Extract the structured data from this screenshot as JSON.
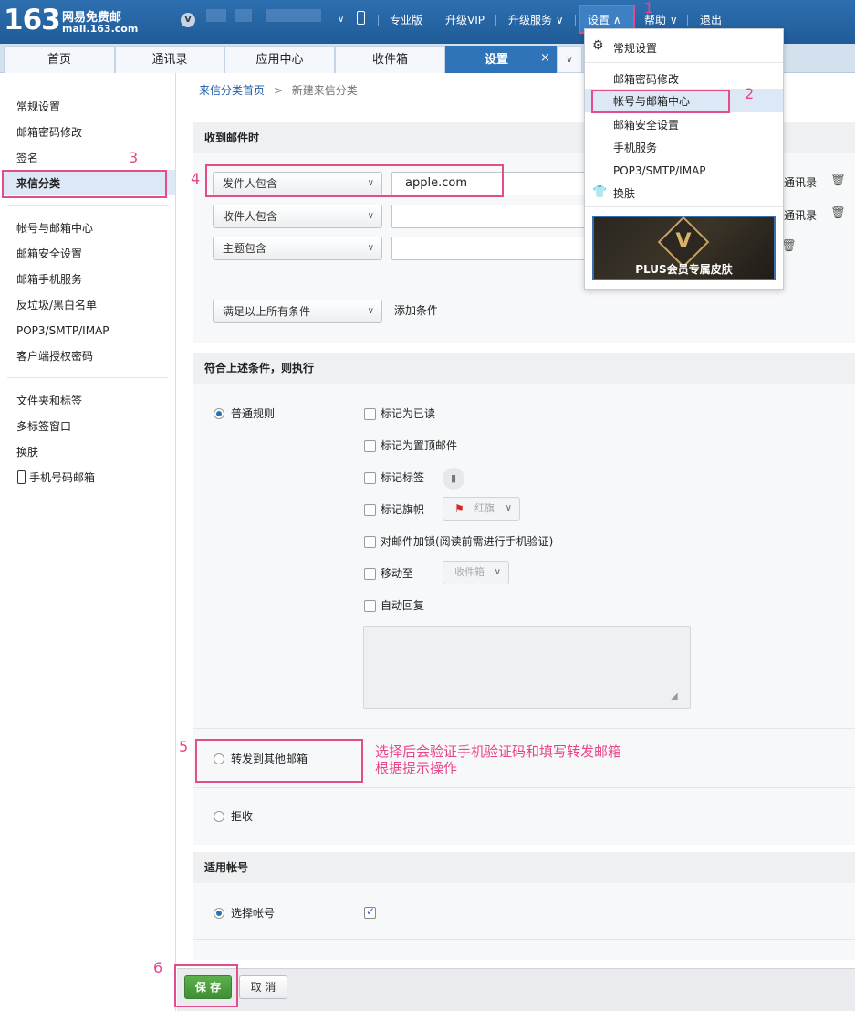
{
  "topbar": {
    "logo_num": "163",
    "logo_title": "网易免费邮",
    "logo_domain": "mail.163.com",
    "vip_badge": "V",
    "nav": [
      "专业版",
      "升级VIP",
      "升级服务 ∨",
      "设置 ∧",
      "帮助 ∨",
      "退出"
    ]
  },
  "tabs": [
    "首页",
    "通讯录",
    "应用中心",
    "收件箱",
    "设置"
  ],
  "tab_close": "×",
  "tab_more": "∨",
  "sidebar": {
    "group1": [
      "常规设置",
      "邮箱密码修改",
      "签名",
      "来信分类"
    ],
    "group2": [
      "帐号与邮箱中心",
      "邮箱安全设置",
      "邮箱手机服务",
      "反垃圾/黑白名单",
      "POP3/SMTP/IMAP",
      "客户端授权密码"
    ],
    "group3": [
      "文件夹和标签",
      "多标签窗口",
      "换肤",
      "手机号码邮箱"
    ]
  },
  "breadcrumb": {
    "home": "来信分类首页",
    "sep": ">",
    "current": "新建来信分类"
  },
  "section_receive": {
    "title": "收到邮件时",
    "conditions": [
      {
        "select": "发件人包含",
        "value": "apple.com",
        "contact_link": "通讯录"
      },
      {
        "select": "收件人包含",
        "value": "",
        "contact_link": "通讯录"
      },
      {
        "select": "主题包含",
        "value": "",
        "contact_link": ""
      }
    ],
    "match_select": "满足以上所有条件",
    "add_condition": "添加条件"
  },
  "section_action": {
    "title": "符合上述条件，则执行",
    "normal_rule": "普通规则",
    "options": [
      "标记为已读",
      "标记为置顶邮件",
      "标记标签",
      "标记旗帜",
      "对邮件加锁(阅读前需进行手机验证)",
      "移动至",
      "自动回复"
    ],
    "flag_select": "红旗",
    "move_select": "收件箱",
    "forward": "转发到其他邮箱",
    "reject": "拒收"
  },
  "annotation": {
    "line1": "选择后会验证手机验证码和填写转发邮箱",
    "line2": "根据提示操作"
  },
  "section_account": {
    "title": "适用帐号",
    "select_account": "选择帐号"
  },
  "buttons": {
    "save": "保 存",
    "cancel": "取 消"
  },
  "dropdown_menu": {
    "items": [
      "常规设置",
      "邮箱密码修改",
      "帐号与邮箱中心",
      "邮箱安全设置",
      "手机服务",
      "POP3/SMTP/IMAP",
      "换肤"
    ],
    "promo": "PLUS会员专属皮肤",
    "promo_logo": "V"
  },
  "step_numbers": [
    "1",
    "2",
    "3",
    "4",
    "5",
    "6"
  ],
  "colors": {
    "topbar": "#2466a6",
    "active_tab": "#2f74b8",
    "highlight": "#e44d8c",
    "link": "#1f5fa8",
    "save_button": "#4a9c3e"
  }
}
